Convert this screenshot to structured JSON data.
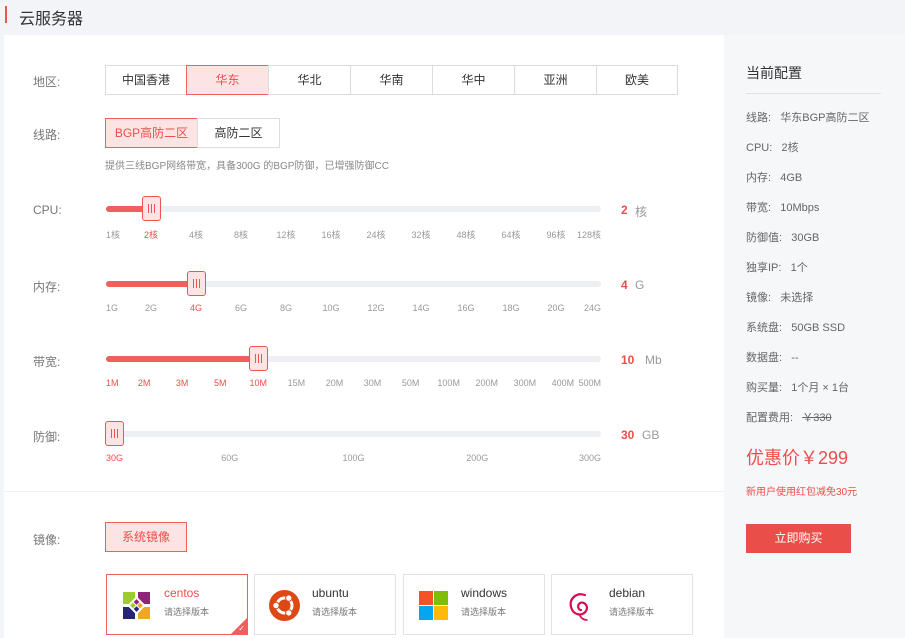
{
  "header": {
    "title": "云服务器"
  },
  "region": {
    "label": "地区:",
    "options": [
      "中国香港",
      "华东",
      "华北",
      "华南",
      "华中",
      "亚洲",
      "欧美"
    ],
    "selected": "华东"
  },
  "line": {
    "label": "线路:",
    "options": [
      "BGP高防二区",
      "高防二区"
    ],
    "selected": "BGP高防二区",
    "hint": "提供三线BGP网络带宽，具备300G 的BGP防御，已增强防御CC"
  },
  "cpu": {
    "label": "CPU:",
    "ticks": [
      "1核",
      "2核",
      "4核",
      "8核",
      "12核",
      "16核",
      "24核",
      "32核",
      "48核",
      "64核",
      "96核",
      "128核"
    ],
    "selected_index": 1,
    "value": "2",
    "unit": "核"
  },
  "memory": {
    "label": "内存:",
    "ticks": [
      "1G",
      "2G",
      "4G",
      "6G",
      "8G",
      "10G",
      "12G",
      "14G",
      "16G",
      "18G",
      "20G",
      "24G"
    ],
    "selected_index": 2,
    "value": "4",
    "unit": "G"
  },
  "bandwidth": {
    "label": "带宽:",
    "ticks": [
      "1M",
      "2M",
      "3M",
      "5M",
      "10M",
      "15M",
      "20M",
      "30M",
      "50M",
      "100M",
      "200M",
      "300M",
      "400M",
      "500M"
    ],
    "selected_index": 4,
    "value": "10",
    "unit": "Mb"
  },
  "defense": {
    "label": "防御:",
    "ticks": [
      "30G",
      "60G",
      "100G",
      "200G",
      "300G"
    ],
    "selected_index": 0,
    "value": "30",
    "unit": "GB"
  },
  "image": {
    "label": "镜像:",
    "button": "系统镜像",
    "os": [
      {
        "name": "centos",
        "sub": "请选择版本",
        "icon": "centos-icon",
        "selected": true
      },
      {
        "name": "ubuntu",
        "sub": "请选择版本",
        "icon": "ubuntu-icon",
        "selected": false
      },
      {
        "name": "windows",
        "sub": "请选择版本",
        "icon": "windows-icon",
        "selected": false
      },
      {
        "name": "debian",
        "sub": "请选择版本",
        "icon": "debian-icon",
        "selected": false
      }
    ]
  },
  "summary": {
    "title": "当前配置",
    "rows": [
      {
        "k": "线路:",
        "v": "华东BGP高防二区"
      },
      {
        "k": "CPU:",
        "v": "2核"
      },
      {
        "k": "内存:",
        "v": "4GB"
      },
      {
        "k": "带宽:",
        "v": "10Mbps"
      },
      {
        "k": "防御值:",
        "v": "30GB"
      },
      {
        "k": "独享IP:",
        "v": "1个"
      },
      {
        "k": "镜像:",
        "v": "未选择"
      },
      {
        "k": "系统盘:",
        "v": "50GB SSD"
      },
      {
        "k": "数据盘:",
        "v": "--"
      },
      {
        "k": "购买量:",
        "v": "1个月 × 1台"
      },
      {
        "k": "配置费用:",
        "v": "￥330"
      }
    ],
    "price": "优惠价￥299",
    "promo": "新用户使用红包减免30元",
    "buy": "立即购买"
  },
  "colors": {
    "accent": "#ee4d49",
    "accent_light": "#fde4e4",
    "track": "#eeeff3"
  }
}
